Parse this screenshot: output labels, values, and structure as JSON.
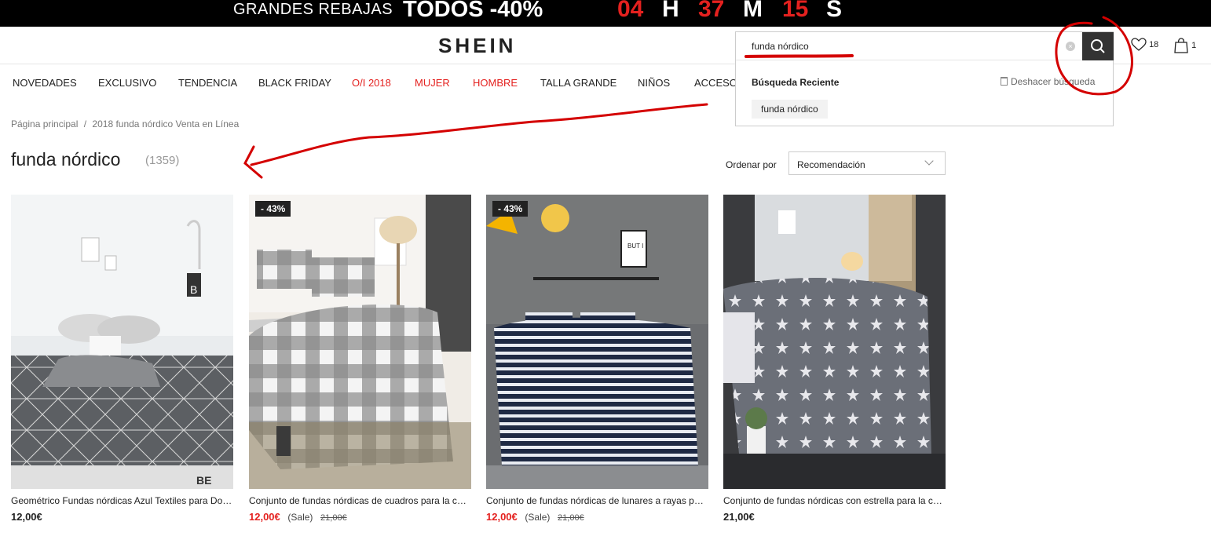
{
  "promo": {
    "text": "GRANDES REBAJAS",
    "offer": "TODOS -40%",
    "hours": "04",
    "hours_unit": "H",
    "minutes": "37",
    "minutes_unit": "M",
    "seconds": "15",
    "seconds_unit": "S"
  },
  "header": {
    "logo": "SHEIN",
    "wishlist_count": "18",
    "cart_count": "1"
  },
  "search": {
    "value": "funda nórdico",
    "recent_title": "Búsqueda Reciente",
    "undo_label": "Deshacer búsqueda",
    "recent_items": [
      "funda nórdico"
    ]
  },
  "nav": {
    "items": [
      "NOVEDADES",
      "EXCLUSIVO",
      "TENDENCIA",
      "BLACK FRIDAY",
      "O/I 2018",
      "MUJER",
      "HOMBRE",
      "TALLA GRANDE",
      "NIÑOS",
      "ACCESORIOS"
    ]
  },
  "breadcrumb": {
    "home": "Página principal",
    "separator": "/",
    "current": "2018 funda nórdico Venta en Línea"
  },
  "results": {
    "title": "funda nórdico",
    "count": "(1359)"
  },
  "sort": {
    "label": "Ordenar por",
    "value": "Recomendación"
  },
  "products": [
    {
      "name": "Geométrico Fundas nórdicas Azul Textiles para Dormitorio",
      "price": "12,00€",
      "sale_label": "",
      "old_price": "",
      "badge": "",
      "image": "bedding-geometric-grey"
    },
    {
      "name": "Conjunto de fundas nórdicas de cuadros para la cama",
      "price": "12,00€",
      "sale_label": "(Sale)",
      "old_price": "21,00€",
      "badge": "- 43%",
      "image": "bedding-gingham-check"
    },
    {
      "name": "Conjunto de fundas nórdicas de lunares a rayas para cama",
      "price": "12,00€",
      "sale_label": "(Sale)",
      "old_price": "21,00€",
      "badge": "- 43%",
      "image": "bedding-navy-stripes"
    },
    {
      "name": "Conjunto de fundas nórdicas con estrella para la cama",
      "price": "21,00€",
      "sale_label": "",
      "old_price": "",
      "badge": "",
      "image": "bedding-grey-stars"
    }
  ],
  "colors": {
    "promo_red": "#e4211f",
    "sale_red": "#e4211f",
    "annotation_red": "#d40000",
    "search_button": "#333333"
  }
}
